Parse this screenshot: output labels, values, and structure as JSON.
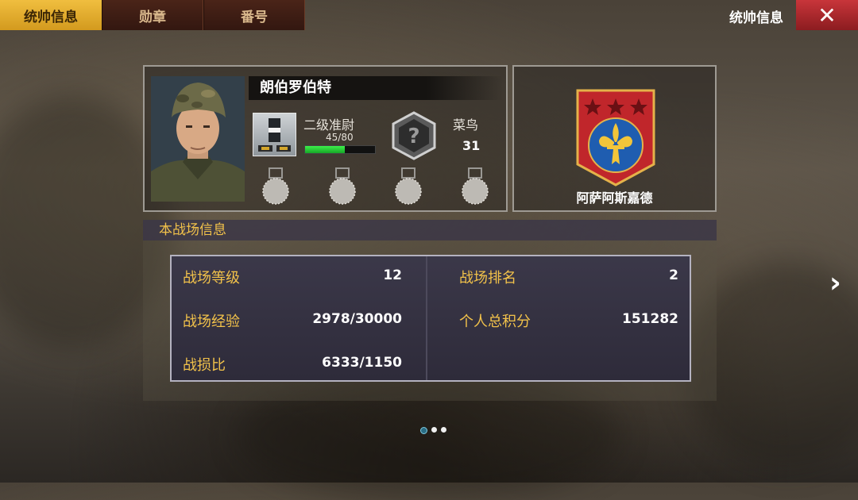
{
  "tabs": [
    {
      "label": "统帅信息",
      "active": true
    },
    {
      "label": "勋章",
      "active": false
    },
    {
      "label": "番号",
      "active": false
    }
  ],
  "header": {
    "title": "统帅信息"
  },
  "profile": {
    "name": "朗伯罗伯特",
    "rank": {
      "name": "二级准尉",
      "xp_text": "45/80",
      "xp_fraction": 0.5625
    },
    "title": {
      "name": "菜鸟",
      "level": "31"
    },
    "medal_slots": 4
  },
  "faction": {
    "name": "阿萨阿斯嘉德"
  },
  "battlefield": {
    "section_title": "本战场信息",
    "left": [
      {
        "label": "战场等级",
        "value": "12"
      },
      {
        "label": "战场经验",
        "value": "2978/30000"
      },
      {
        "label": "战损比",
        "value": "6333/1150"
      }
    ],
    "right": [
      {
        "label": "战场排名",
        "value": "2"
      },
      {
        "label": "个人总积分",
        "value": "151282"
      }
    ]
  },
  "pagination": {
    "pages": 3,
    "current": 1
  },
  "colors": {
    "accent": "#f2c24a",
    "tab_active": "#e0aa2a",
    "close": "#b0282d",
    "xp": "#2fd23c"
  }
}
